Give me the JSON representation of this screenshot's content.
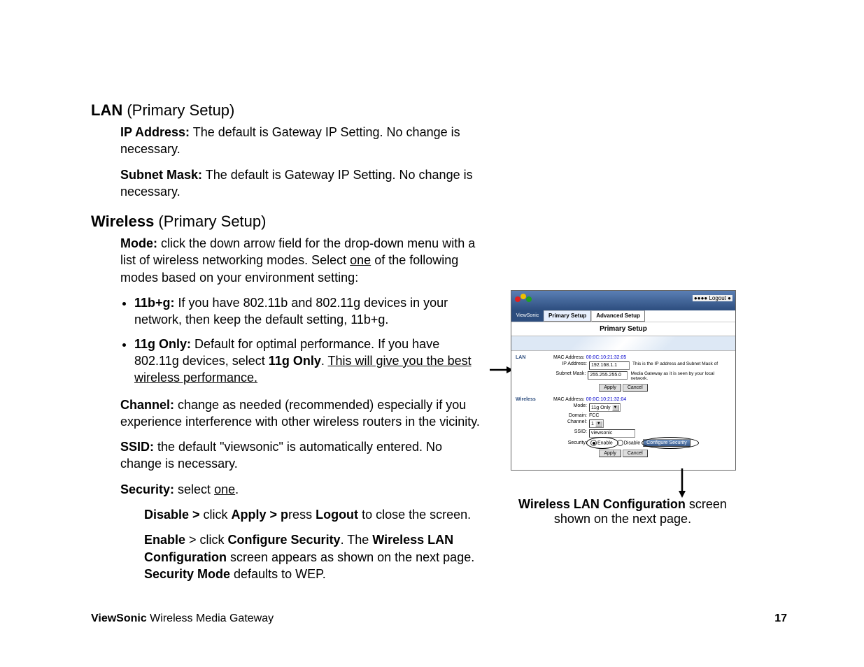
{
  "doc": {
    "lan": {
      "heading_bold": "LAN",
      "heading_rest": " (Primary Setup)",
      "ip_label": "IP Address:",
      "ip_text": " The default is Gateway IP Setting. No change is necessary.",
      "sm_label": "Subnet Mask:",
      "sm_text": " The default is Gateway IP Setting. No change is necessary."
    },
    "wireless": {
      "heading_bold": "Wireless",
      "heading_rest": " (Primary Setup)",
      "mode_label": "Mode:",
      "mode_text1": " click the down arrow field for the drop-down menu with a list of wireless networking modes. Select ",
      "mode_one": "one",
      "mode_text2": " of the following modes based on your environment setting:",
      "b11bg_label": "11b+g:",
      "b11bg_text": " If you have 802.11b and 802.11g devices in your network, then keep the default setting, 11b+g.",
      "b11g_label": "11g Only:",
      "b11g_text1": " Default for optimal performance. If you have 802.11g devices, select ",
      "b11g_bold": "11g Only",
      "b11g_text2": ". ",
      "b11g_under": "This will give you the best wireless performance.",
      "channel_label": "Channel:",
      "channel_text": " change as needed (recommended) especially if you experience interference with other wireless routers in the vicinity.",
      "ssid_label": "SSID:",
      "ssid_text": " the default \"viewsonic\" is automatically entered. No change is necessary.",
      "security_label": "Security:",
      "security_text1": " select ",
      "security_one": "one",
      "security_text2": ".",
      "disable_bold": "Disable > ",
      "disable_text1": "click ",
      "apply_bold": "Apply > p",
      "disable_text2": "ress ",
      "logout_bold": "Logout",
      "disable_text3": " to close the screen.",
      "enable_bold": "Enable",
      "enable_text1": " > click ",
      "config_bold": "Configure Security",
      "enable_text2": ". The ",
      "wlc_bold": "Wireless LAN Configuration",
      "enable_text3": " screen appears as shown on the next page. ",
      "secmode_bold": "Security Mode",
      "enable_text4": " defaults to WEP."
    },
    "caption_bold": "Wireless LAN Configuration",
    "caption_rest": " screen shown on the next page.",
    "footer_brand": "ViewSonic",
    "footer_product": " Wireless Media Gateway",
    "page_num": "17"
  },
  "ss": {
    "logout": "●●●● Logout ●",
    "logo": "ViewSonic",
    "tab_primary": "Primary Setup",
    "tab_advanced": "Advanced Setup",
    "title": "Primary Setup",
    "lan": {
      "label": "LAN",
      "mac_label": "MAC Address:",
      "mac_value": "00:0C:10:21:32:05",
      "ip_label": "IP Address:",
      "ip_value": "192.168.1.1",
      "ip_hint": "This is the IP address and Subnet Mask of",
      "sm_label": "Subnet Mask:",
      "sm_value": "255.255.255.0",
      "sm_hint": "Media Gateway as it is seen by your local network."
    },
    "wireless": {
      "label": "Wireless",
      "mac_label": "MAC Address:",
      "mac_value": "00:0C:10:21:32:04",
      "mode_label": "Mode:",
      "mode_value": "11g Only",
      "domain_label": "Domain:",
      "domain_value": "FCC",
      "channel_label": "Channel:",
      "channel_value": "1",
      "ssid_label": "SSID:",
      "ssid_value": "viewsonic",
      "security_label": "Security:",
      "enable": "Enable",
      "disable": "Disable",
      "config_btn": "Configure Security"
    },
    "apply_btn": "Apply",
    "cancel_btn": "Cancel"
  }
}
